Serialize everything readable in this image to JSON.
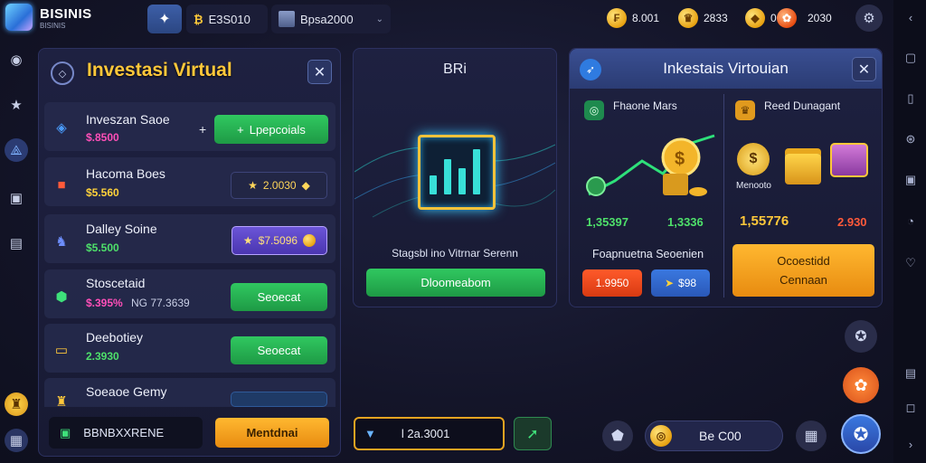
{
  "app": {
    "title": "BISINIS",
    "subtitle": "BISINIS"
  },
  "topbar": {
    "pill1": {
      "icon": "currency-icon",
      "value": "E3S010"
    },
    "pill2": {
      "icon": "crate-icon",
      "value": "Bpsa2000"
    },
    "currencies": [
      {
        "icon": "gold-coin-icon",
        "value": "8.001"
      },
      {
        "icon": "crown-coin-icon",
        "value": "2833"
      },
      {
        "icon": "gem-icon",
        "value": "0.4"
      },
      {
        "icon": "ruby-icon",
        "value": "2030"
      }
    ]
  },
  "left_panel": {
    "title": "Investasi Virtual",
    "rows": [
      {
        "label": "Inveszan Saoe",
        "value": "$.8500",
        "value_color": "#ff4fb8",
        "button": "Lpepcoials",
        "button_style": "green",
        "prefix": "+"
      },
      {
        "label": "Hacoma Boes",
        "value": "$5.560",
        "value_color": "#ffd23a",
        "button": "2.0030",
        "button_style": "dark"
      },
      {
        "label": "Dalley Soine",
        "value": "$5.500",
        "value_color": "#4ee06a",
        "button": "$7.5096",
        "button_style": "purple"
      },
      {
        "label": "Stoscetaid",
        "value": "$.395%",
        "extra": "NG 77.3639",
        "value_color": "#ff4fb8",
        "button": "Seoecat",
        "button_style": "green"
      },
      {
        "label": "Deebotiey",
        "value": "2.3930",
        "value_color": "#4ee06a",
        "button": "Seoecat",
        "button_style": "green"
      },
      {
        "label": "Soeaoe Gemy",
        "value": "",
        "value_color": "#4ee06a",
        "button": "",
        "button_style": "teal"
      }
    ],
    "bottom": {
      "label": "BBNBXXRENE",
      "button": "Mentdnai"
    }
  },
  "mid_panel": {
    "title": "BRi",
    "chart_bars": [
      30,
      55,
      40,
      70
    ],
    "caption": "Stagsbl ino Vitrnar Serenn",
    "button": "Dloomeabom"
  },
  "right_panel": {
    "title": "Inkestais Virtouian",
    "left": {
      "label": "Fhaone Mars",
      "stat1": "1,35397",
      "stat2": "1,3336",
      "caption": "Foapnuetna Seoenien",
      "btn_red": "1.9950",
      "btn_blue": "$98"
    },
    "right": {
      "label": "Reed Dunagant",
      "small_label": "Menooto",
      "stat1": "1,55776",
      "stat2": "2.930",
      "cta_line1": "Ocoestidd",
      "cta_line2": "Cennaan"
    }
  },
  "bottom_mid": {
    "input_value": "l 2a.3001"
  },
  "bottom_right": {
    "balance": "Be C00"
  }
}
